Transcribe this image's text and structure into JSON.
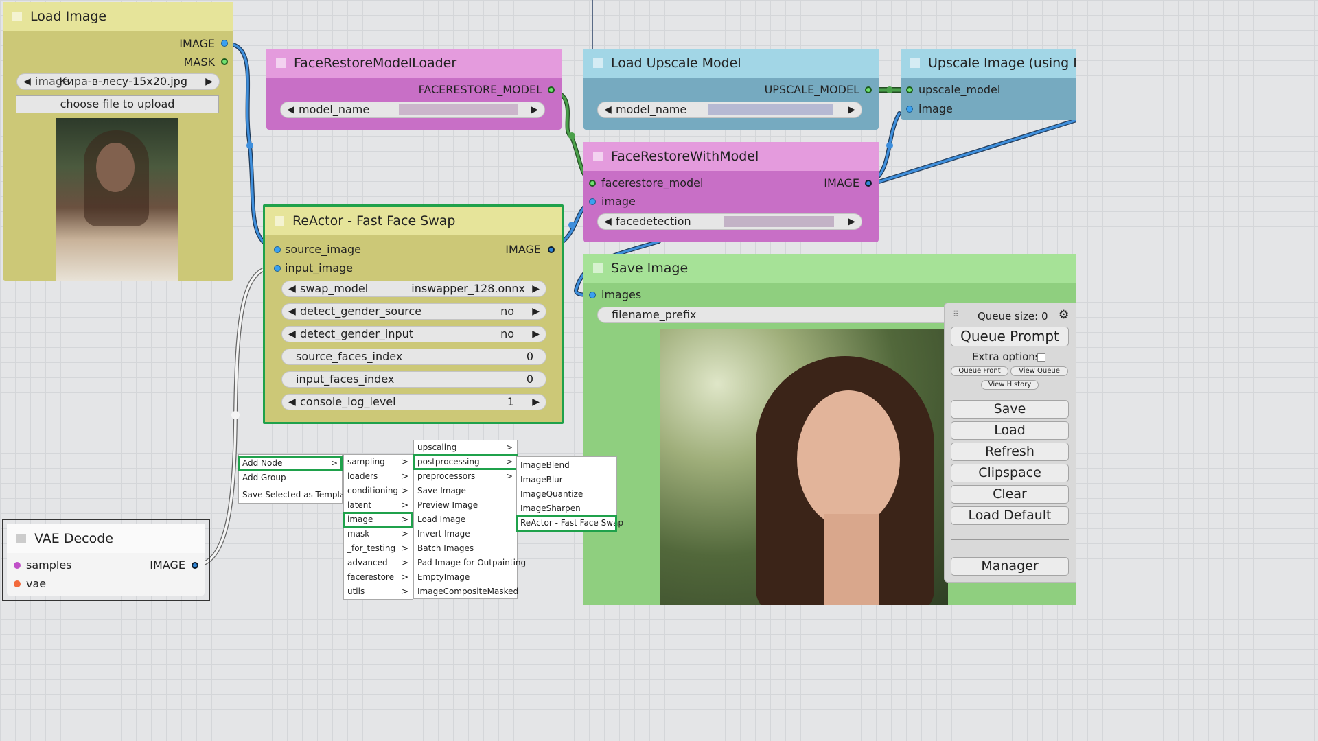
{
  "load_image": {
    "title": "Load Image",
    "out_image": "IMAGE",
    "out_mask": "MASK",
    "image_label": "image",
    "image_value": "Кира-в-лесу-15x20.jpg",
    "upload_button": "choose file to upload"
  },
  "face_restore_loader": {
    "title": "FaceRestoreModelLoader",
    "out_model": "FACERESTORE_MODEL",
    "model_name_label": "model_name"
  },
  "load_upscale": {
    "title": "Load Upscale Model",
    "out_model": "UPSCALE_MODEL",
    "model_name_label": "model_name"
  },
  "upscale_image": {
    "title": "Upscale Image (using Mo",
    "in_upscale_model": "upscale_model",
    "in_image": "image"
  },
  "face_restore_with_model": {
    "title": "FaceRestoreWithModel",
    "in_model": "facerestore_model",
    "in_image": "image",
    "out_image": "IMAGE",
    "facedetection_label": "facedetection"
  },
  "reactor": {
    "title": "ReActor - Fast Face Swap",
    "in_source": "source_image",
    "in_input": "input_image",
    "out_image": "IMAGE",
    "widgets": [
      {
        "label": "swap_model",
        "value": "inswapper_128.onnx",
        "arrows": true
      },
      {
        "label": "detect_gender_source",
        "value": "no",
        "arrows": true
      },
      {
        "label": "detect_gender_input",
        "value": "no",
        "arrows": true
      },
      {
        "label": "source_faces_index",
        "value": "0",
        "arrows": false
      },
      {
        "label": "input_faces_index",
        "value": "0",
        "arrows": false
      },
      {
        "label": "console_log_level",
        "value": "1",
        "arrows": true
      }
    ]
  },
  "save_image": {
    "title": "Save Image",
    "in_images": "images",
    "filename_label": "filename_prefix"
  },
  "vae_decode": {
    "title": "VAE Decode",
    "in_samples": "samples",
    "in_vae": "vae",
    "out_image": "IMAGE"
  },
  "context_menu": {
    "main": [
      "Add Node",
      "Add Group",
      "Save Selected as Template"
    ],
    "categories": [
      "sampling",
      "loaders",
      "conditioning",
      "latent",
      "image",
      "mask",
      "_for_testing",
      "advanced",
      "facerestore",
      "utils"
    ],
    "image_items": [
      "upscaling",
      "postprocessing",
      "preprocessors",
      "Save Image",
      "Preview Image",
      "Load Image",
      "Invert Image",
      "Batch Images",
      "Pad Image for Outpainting",
      "EmptyImage",
      "ImageCompositeMasked"
    ],
    "postprocessing_items": [
      "ImageBlend",
      "ImageBlur",
      "ImageQuantize",
      "ImageSharpen",
      "ReActor - Fast Face Swap"
    ],
    "submenu_arrow": ">"
  },
  "queue_panel": {
    "queue_size": "Queue size: 0",
    "queue_prompt": "Queue Prompt",
    "extra_options": "Extra options",
    "queue_front": "Queue Front",
    "view_queue": "View Queue",
    "view_history": "View History",
    "save": "Save",
    "load": "Load",
    "refresh": "Refresh",
    "clipspace": "Clipspace",
    "clear": "Clear",
    "load_default": "Load Default",
    "manager": "Manager"
  },
  "colors": {
    "yellow_node": "#e6e49a",
    "pink_node": "#d58ad0",
    "blue_node": "#8fc6d6",
    "green_node": "#9fdc8f",
    "highlight": "#1fa14b",
    "wire_blue": "#3f8fdc",
    "wire_green": "#4aa04a"
  }
}
